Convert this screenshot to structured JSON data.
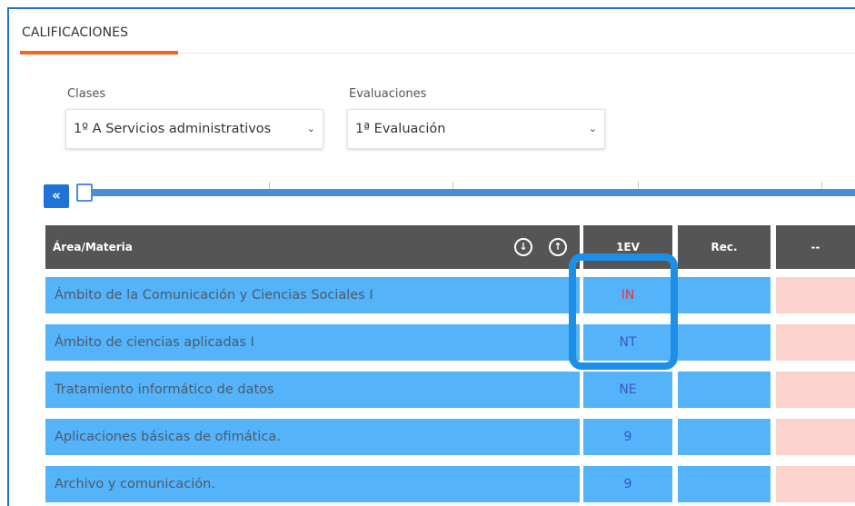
{
  "tab": {
    "label": "CALIFICACIONES"
  },
  "filters": {
    "clases": {
      "label": "Clases",
      "value": "1º A Servicios administrativos"
    },
    "evaluaciones": {
      "label": "Evaluaciones",
      "value": "1ª Evaluación"
    }
  },
  "timeline": {
    "collapse_label": "«"
  },
  "table": {
    "headers": {
      "subject": "Área/Materia",
      "sort_down": "↓",
      "sort_up": "↑",
      "ev1": "1EV",
      "rec": "Rec.",
      "extra": "--"
    },
    "rows": [
      {
        "subject": "Ámbito de la Comunicación y Ciencias Sociales I",
        "grade": "IN",
        "grade_color": "#e2354d"
      },
      {
        "subject": "Ámbito de ciencias aplicadas I",
        "grade": "NT",
        "grade_color": "#3a57c4"
      },
      {
        "subject": "Tratamiento informático de datos",
        "grade": "NE",
        "grade_color": "#3a57c4"
      },
      {
        "subject": "Aplicaciones básicas de ofimática.",
        "grade": "9",
        "grade_color": "#3a57c4"
      },
      {
        "subject": "Archivo y comunicación.",
        "grade": "9",
        "grade_color": "#3a57c4"
      }
    ]
  },
  "colors": {
    "accent": "#1e74d6",
    "tab_underline": "#f26522",
    "header_bg": "#555555",
    "row_bg": "#55b3fa",
    "extra_col_bg": "#fbd2cc",
    "highlight": "#1e8fe6"
  }
}
